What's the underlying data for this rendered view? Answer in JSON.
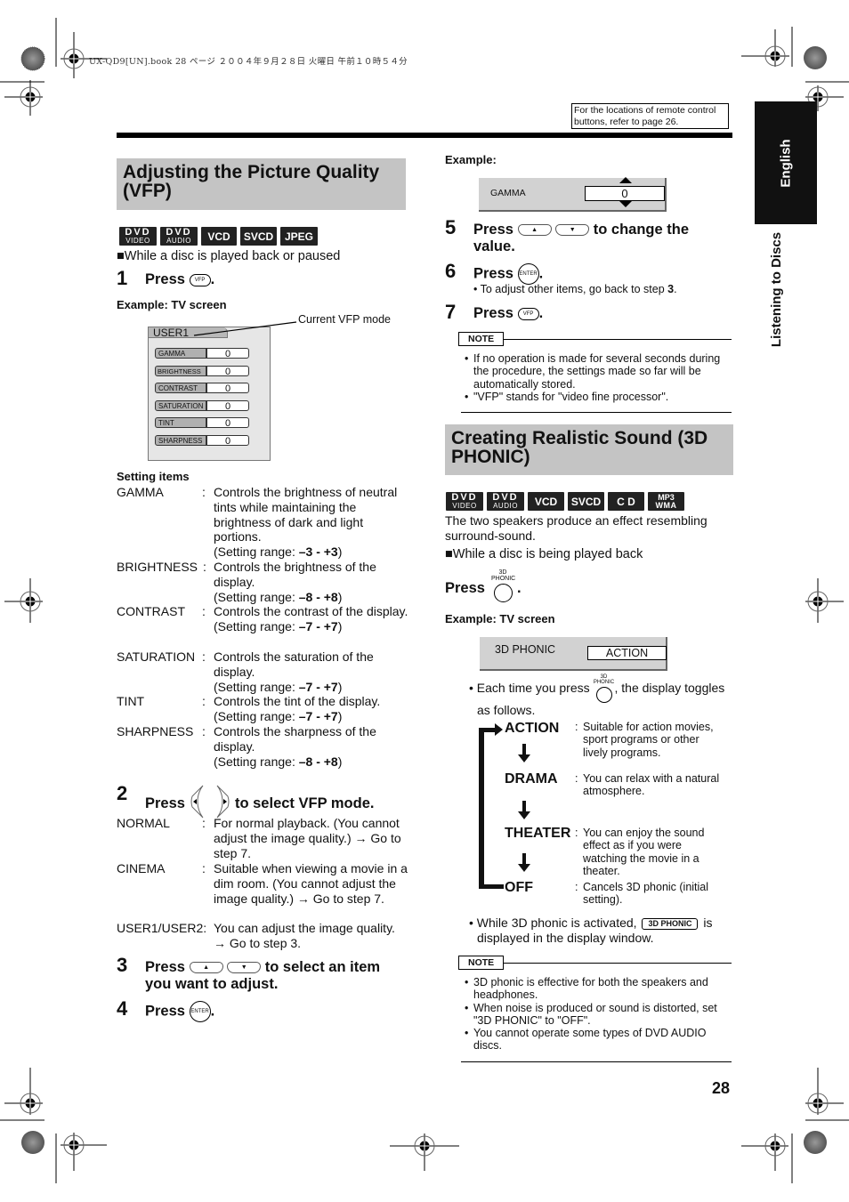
{
  "header": {
    "print_meta": "UX-QD9[UN].book  28 ページ  ２００４年９月２８日  火曜日  午前１０時５４分",
    "remote_ref": "For the locations of remote control buttons, refer to page 26."
  },
  "side_tabs": {
    "language": "English",
    "section": "Listening to Discs"
  },
  "vfp": {
    "title": "Adjusting the Picture Quality (VFP)",
    "badges": [
      {
        "top": "DVD",
        "bottom": "VIDEO"
      },
      {
        "top": "DVD",
        "bottom": "AUDIO"
      },
      {
        "label": "VCD"
      },
      {
        "label": "SVCD"
      },
      {
        "label": "JPEG"
      }
    ],
    "condition": "■While a disc is played back or paused",
    "step1": {
      "num": "1",
      "text": "Press",
      "button": "VFP",
      "end": "."
    },
    "example_label": "Example: TV screen",
    "screen": {
      "mode": "USER1",
      "callout": "Current VFP mode",
      "rows": [
        {
          "label": "GAMMA",
          "value": "0"
        },
        {
          "label": "BRIGHTNESS",
          "value": "0"
        },
        {
          "label": "CONTRAST",
          "value": "0"
        },
        {
          "label": "SATURATION",
          "value": "0"
        },
        {
          "label": "TINT",
          "value": "0"
        },
        {
          "label": "SHARPNESS",
          "value": "0"
        }
      ]
    },
    "setting_items_title": "Setting items",
    "setting_items": [
      {
        "key": "GAMMA",
        "desc": "Controls the brightness of neutral tints while maintaining the brightness of dark and light portions.",
        "range_prefix": "(Setting range: ",
        "range": "–3 - +3",
        "range_suffix": ")"
      },
      {
        "key": "BRIGHTNESS",
        "desc": "Controls the brightness of the display.",
        "range_prefix": "(Setting range: ",
        "range": "–8 - +8",
        "range_suffix": ")"
      },
      {
        "key": "CONTRAST",
        "desc": "Controls the contrast of the display.",
        "range_prefix": "(Setting range: ",
        "range": "–7 - +7",
        "range_suffix": ")"
      },
      {
        "key": "SATURATION",
        "desc": "Controls the saturation of the display.",
        "range_prefix": "(Setting range: ",
        "range": "–7 - +7",
        "range_suffix": ")"
      },
      {
        "key": "TINT",
        "desc": "Controls the tint of the display.",
        "range_prefix": "(Setting range: ",
        "range": "–7 - +7",
        "range_suffix": ")"
      },
      {
        "key": "SHARPNESS",
        "desc": "Controls the sharpness of the display.",
        "range_prefix": "(Setting range: ",
        "range": "–8 - +8",
        "range_suffix": ")"
      }
    ],
    "step2": {
      "num": "2",
      "text": "Press",
      "end": "to select VFP mode."
    },
    "modes": [
      {
        "key": "NORMAL",
        "sep": ":",
        "desc": "For normal playback. (You cannot adjust the image quality.) → Go to step 7."
      },
      {
        "key": "CINEMA",
        "sep": ":",
        "desc": "Suitable when viewing a movie in a dim room. (You cannot adjust the image quality.) → Go to step 7."
      },
      {
        "key": "USER1/USER2:",
        "sep": "",
        "desc": "You can adjust the image quality. → Go to step 3."
      }
    ],
    "step3": {
      "num": "3",
      "text": "Press",
      "end": "to select an item you want to adjust."
    },
    "step4": {
      "num": "4",
      "text": "Press",
      "button": "ENTER",
      "end": "."
    }
  },
  "right": {
    "example_label": "Example:",
    "gamma_screen": {
      "label": "GAMMA",
      "value": "0"
    },
    "step5": {
      "num": "5",
      "text": "Press",
      "end": "to change the value."
    },
    "step6": {
      "num": "6",
      "text": "Press",
      "button": "ENTER",
      "end": ".",
      "sub_prefix": "• To adjust other items, go back to step ",
      "sub_step": "3",
      "sub_suffix": "."
    },
    "step7": {
      "num": "7",
      "text": "Press",
      "button": "VFP",
      "end": "."
    },
    "note1": {
      "tag": "NOTE",
      "items": [
        "If no operation is made for several seconds during the procedure, the settings made so far will be automatically stored.",
        "\"VFP\" stands for \"video fine processor\"."
      ]
    }
  },
  "phonic": {
    "title": "Creating Realistic Sound (3D PHONIC)",
    "badges": [
      {
        "top": "DVD",
        "bottom": "VIDEO"
      },
      {
        "top": "DVD",
        "bottom": "AUDIO"
      },
      {
        "label": "VCD"
      },
      {
        "label": "SVCD"
      },
      {
        "label": "C D"
      },
      {
        "top": "MP3",
        "bottom": "WMA"
      }
    ],
    "intro": "The two speakers produce an effect resembling surround-sound.",
    "condition": "■While a disc is being played back",
    "press": "Press",
    "button_top": "3D",
    "button_bottom": "PHONIC",
    "press_end": ".",
    "example_label": "Example: TV screen",
    "screen": {
      "label": "3D PHONIC",
      "value": "ACTION"
    },
    "toggle_prefix": "• Each time you press",
    "toggle_suffix": ", the display toggles",
    "toggle_line2": "as follows.",
    "modes": [
      {
        "key": "ACTION",
        "desc": "Suitable for action movies, sport programs or other lively programs."
      },
      {
        "key": "DRAMA",
        "desc": "You can relax with a natural atmosphere."
      },
      {
        "key": "THEATER",
        "desc": "You can enjoy the sound effect as if you were watching the movie in a theater."
      },
      {
        "key": "OFF",
        "desc": "Cancels 3D phonic (initial setting)."
      }
    ],
    "activated_prefix": "• While 3D phonic is activated,",
    "activated_indicator": "3D PHONIC",
    "activated_suffix": "is",
    "activated_line2": "displayed in the display window.",
    "note2": {
      "tag": "NOTE",
      "items": [
        "3D phonic is effective for both the speakers and headphones.",
        "When noise is produced or sound is distorted, set \"3D PHONIC\" to \"OFF\".",
        "You cannot operate some types of DVD AUDIO discs."
      ]
    }
  },
  "footer": {
    "page_number": "28"
  }
}
